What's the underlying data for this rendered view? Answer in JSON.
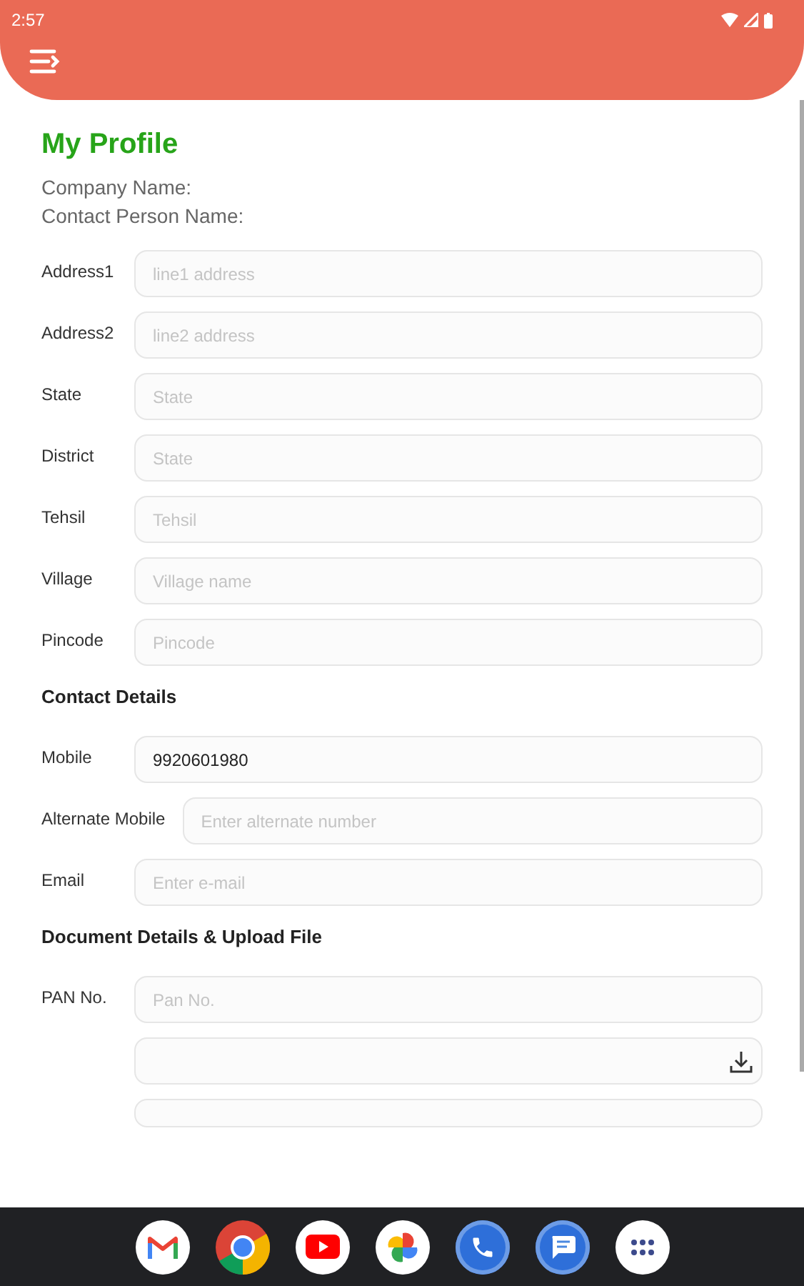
{
  "status_bar": {
    "time": "2:57"
  },
  "title": "My Profile",
  "info": [
    "Company Name:",
    "Contact Person Name:"
  ],
  "sections": [
    {
      "fields": [
        {
          "label": "Address1",
          "placeholder": "line1 address"
        },
        {
          "label": "Address2",
          "placeholder": "line2 address"
        },
        {
          "label": "State",
          "placeholder": "State"
        },
        {
          "label": "District",
          "placeholder": "State"
        },
        {
          "label": "Tehsil",
          "placeholder": "Tehsil"
        },
        {
          "label": "Village",
          "placeholder": "Village name"
        },
        {
          "label": "Pincode",
          "placeholder": "Pincode"
        }
      ]
    },
    {
      "heading": "Contact Details",
      "fields": [
        {
          "label": "Mobile",
          "value": "9920601980"
        },
        {
          "label": "Alternate Mobile",
          "placeholder": "Enter alternate number"
        },
        {
          "label": "Email",
          "placeholder": "Enter e-mail"
        }
      ]
    },
    {
      "heading": "Document Details & Upload File",
      "fields": [
        {
          "label": "PAN No.",
          "placeholder": "Pan No."
        },
        {
          "kind": "upload"
        },
        {
          "kind": "cut"
        }
      ]
    }
  ],
  "dock": [
    {
      "kind": "mail"
    },
    {
      "kind": "browser"
    },
    {
      "kind": "video"
    },
    {
      "kind": "photos"
    },
    {
      "kind": "phone"
    },
    {
      "kind": "messages"
    },
    {
      "kind": "apps"
    }
  ]
}
